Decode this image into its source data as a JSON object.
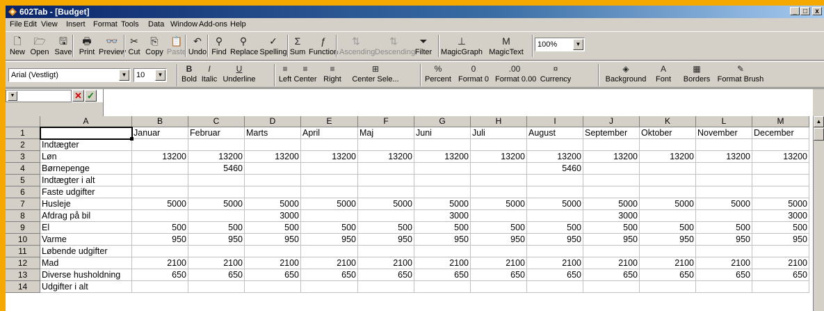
{
  "window": {
    "title": "602Tab - [Budget]",
    "minimize": "_",
    "restore": "□",
    "close": "x"
  },
  "menu": [
    "File",
    "Edit",
    "View",
    "Insert",
    "Format",
    "Tools",
    "Data",
    "Window",
    "Add-ons",
    "Help"
  ],
  "toolbar1": [
    {
      "label": "New",
      "icon": "new-file-icon",
      "glyph": "🗋",
      "enabled": true
    },
    {
      "label": "Open",
      "icon": "open-folder-icon",
      "glyph": "🗁",
      "enabled": true
    },
    {
      "label": "Save",
      "icon": "save-disk-icon",
      "glyph": "🖫",
      "enabled": true
    },
    {
      "label": "Print",
      "icon": "printer-icon",
      "glyph": "🖶",
      "enabled": true
    },
    {
      "label": "Preview",
      "icon": "preview-glasses-icon",
      "glyph": "👓",
      "enabled": true
    },
    {
      "label": "Cut",
      "icon": "scissors-icon",
      "glyph": "✂",
      "enabled": true
    },
    {
      "label": "Copy",
      "icon": "copy-icon",
      "glyph": "⎘",
      "enabled": true
    },
    {
      "label": "Paste",
      "icon": "paste-clipboard-icon",
      "glyph": "📋",
      "enabled": false
    },
    {
      "label": "Undo",
      "icon": "undo-arrow-icon",
      "glyph": "↶",
      "enabled": true
    },
    {
      "label": "Find",
      "icon": "find-magnifier-icon",
      "glyph": "⚲",
      "enabled": true
    },
    {
      "label": "Replace",
      "icon": "replace-icon",
      "glyph": "⚲",
      "enabled": true
    },
    {
      "label": "Spelling",
      "icon": "spelling-check-icon",
      "glyph": "✓",
      "enabled": true
    },
    {
      "label": "Sum",
      "icon": "sigma-sum-icon",
      "glyph": "Σ",
      "enabled": true
    },
    {
      "label": "Function",
      "icon": "function-fx-icon",
      "glyph": "ƒ",
      "enabled": true
    },
    {
      "label": "Ascending",
      "icon": "sort-ascending-icon",
      "glyph": "⇅",
      "enabled": false
    },
    {
      "label": "Descending",
      "icon": "sort-descending-icon",
      "glyph": "⇅",
      "enabled": false
    },
    {
      "label": "Filter",
      "icon": "filter-funnel-icon",
      "glyph": "⏷",
      "enabled": true
    },
    {
      "label": "MagicGraph",
      "icon": "magic-graph-icon",
      "glyph": "⊥",
      "enabled": true
    },
    {
      "label": "MagicText",
      "icon": "magic-text-icon",
      "glyph": "M",
      "enabled": true
    }
  ],
  "zoom": "100%",
  "font_name": "Arial (Vestligt)",
  "font_size": "10",
  "toolbar2": [
    {
      "label": "Bold",
      "icon": "bold-icon",
      "glyph": "B"
    },
    {
      "label": "Italic",
      "icon": "italic-icon",
      "glyph": "I"
    },
    {
      "label": "Underline",
      "icon": "underline-icon",
      "glyph": "U"
    },
    {
      "label": "Left",
      "icon": "align-left-icon",
      "glyph": "≡"
    },
    {
      "label": "Center",
      "icon": "align-center-icon",
      "glyph": "≡"
    },
    {
      "label": "Right",
      "icon": "align-right-icon",
      "glyph": "≡"
    },
    {
      "label": "Center Sele...",
      "icon": "center-selection-icon",
      "glyph": "⊞"
    },
    {
      "label": "Percent",
      "icon": "percent-icon",
      "glyph": "%"
    },
    {
      "label": "Format 0",
      "icon": "format-0-icon",
      "glyph": "0"
    },
    {
      "label": "Format 0.00",
      "icon": "format-decimals-icon",
      "glyph": ".00"
    },
    {
      "label": "Currency",
      "icon": "currency-icon",
      "glyph": "¤"
    },
    {
      "label": "Background",
      "icon": "background-fill-icon",
      "glyph": "◈"
    },
    {
      "label": "Font",
      "icon": "font-color-icon",
      "glyph": "A"
    },
    {
      "label": "Borders",
      "icon": "borders-icon",
      "glyph": "▦"
    },
    {
      "label": "Format Brush",
      "icon": "format-brush-icon",
      "glyph": "✎"
    }
  ],
  "cell_ref": "A1",
  "formula_buttons": {
    "cancel": "✕",
    "confirm": "✓"
  },
  "sheet": {
    "columns": [
      "A",
      "B",
      "C",
      "D",
      "E",
      "F",
      "G",
      "H",
      "I",
      "J",
      "K",
      "L",
      "M"
    ],
    "row_numbers": [
      "1",
      "2",
      "3",
      "4",
      "5",
      "6",
      "7",
      "8",
      "9",
      "10",
      "11",
      "12",
      "13",
      "14"
    ],
    "rows": [
      [
        "",
        "Januar",
        "Februar",
        "Marts",
        "April",
        "Maj",
        "Juni",
        "Juli",
        "August",
        "September",
        "Oktober",
        "November",
        "December"
      ],
      [
        "Indtægter",
        "",
        "",
        "",
        "",
        "",
        "",
        "",
        "",
        "",
        "",
        "",
        ""
      ],
      [
        "Løn",
        "13200",
        "13200",
        "13200",
        "13200",
        "13200",
        "13200",
        "13200",
        "13200",
        "13200",
        "13200",
        "13200",
        "13200"
      ],
      [
        "Børnepenge",
        "",
        "5460",
        "",
        "",
        "",
        "",
        "",
        "5460",
        "",
        "",
        "",
        ""
      ],
      [
        "Indtægter i alt",
        "",
        "",
        "",
        "",
        "",
        "",
        "",
        "",
        "",
        "",
        "",
        ""
      ],
      [
        "Faste udgifter",
        "",
        "",
        "",
        "",
        "",
        "",
        "",
        "",
        "",
        "",
        "",
        ""
      ],
      [
        "Husleje",
        "5000",
        "5000",
        "5000",
        "5000",
        "5000",
        "5000",
        "5000",
        "5000",
        "5000",
        "5000",
        "5000",
        "5000"
      ],
      [
        "Afdrag på bil",
        "",
        "",
        "3000",
        "",
        "",
        "3000",
        "",
        "",
        "3000",
        "",
        "",
        "3000"
      ],
      [
        "El",
        "500",
        "500",
        "500",
        "500",
        "500",
        "500",
        "500",
        "500",
        "500",
        "500",
        "500",
        "500"
      ],
      [
        "Varme",
        "950",
        "950",
        "950",
        "950",
        "950",
        "950",
        "950",
        "950",
        "950",
        "950",
        "950",
        "950"
      ],
      [
        "Løbende udgifter",
        "",
        "",
        "",
        "",
        "",
        "",
        "",
        "",
        "",
        "",
        "",
        ""
      ],
      [
        "Mad",
        "2100",
        "2100",
        "2100",
        "2100",
        "2100",
        "2100",
        "2100",
        "2100",
        "2100",
        "2100",
        "2100",
        "2100"
      ],
      [
        "Diverse husholdning",
        "650",
        "650",
        "650",
        "650",
        "650",
        "650",
        "650",
        "650",
        "650",
        "650",
        "650",
        "650"
      ],
      [
        "Udgifter i alt",
        "",
        "",
        "",
        "",
        "",
        "",
        "",
        "",
        "",
        "",
        "",
        ""
      ]
    ]
  }
}
